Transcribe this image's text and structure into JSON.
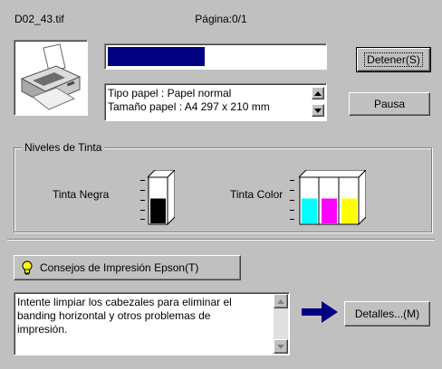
{
  "header": {
    "file_name": "D02_43.tif",
    "page_label": "Página:0/1"
  },
  "progress": {
    "fraction": 0.45,
    "color": "#000080"
  },
  "buttons": {
    "stop": "Detener(S)",
    "pause": "Pausa",
    "tips": "Consejos de Impresión Epson(T)",
    "details": "Detalles...(M)"
  },
  "paper_info": {
    "line1": "Tipo papel : Papel normal",
    "line2": "Tamaño papel : A4 297 x 210 mm"
  },
  "ink_levels": {
    "title": "Niveles de Tinta",
    "black_label": "Tinta Negra",
    "color_label": "Tinta Color",
    "black_level": 0.55,
    "color_levels": [
      {
        "name": "cyan",
        "color": "#00ffff",
        "level": 0.55
      },
      {
        "name": "magenta",
        "color": "#ff00ff",
        "level": 0.55
      },
      {
        "name": "yellow",
        "color": "#ffff00",
        "level": 0.55
      }
    ]
  },
  "tip_message": "Intente limpiar los cabezales para eliminar el banding horizontal y otros problemas de impresión.",
  "icons": {
    "printer": "printer-icon",
    "tip": "lightbulb-icon",
    "arrow": "arrow-right-icon"
  }
}
